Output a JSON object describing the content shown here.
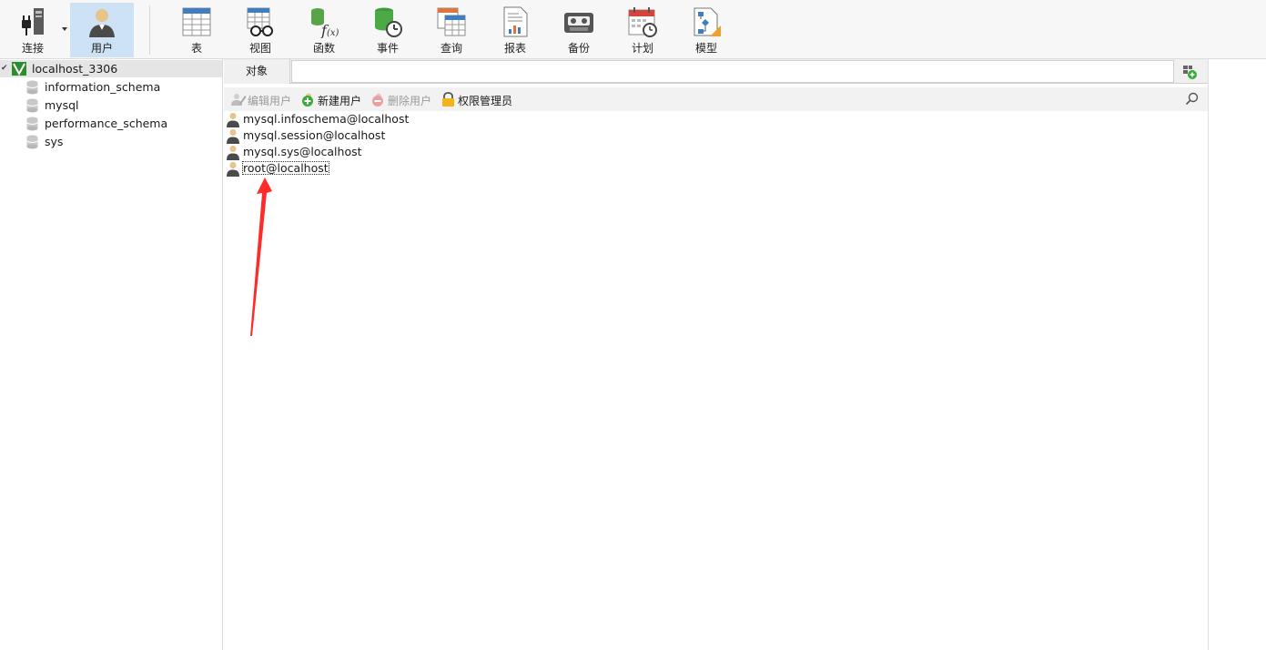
{
  "toolbar": {
    "buttons": [
      {
        "label": "连接",
        "icon": "connection-plug-icon"
      },
      {
        "label": "用户",
        "icon": "user-icon",
        "active": true
      },
      {
        "label": "表",
        "icon": "table-icon"
      },
      {
        "label": "视图",
        "icon": "view-icon"
      },
      {
        "label": "函数",
        "icon": "function-icon"
      },
      {
        "label": "事件",
        "icon": "event-icon"
      },
      {
        "label": "查询",
        "icon": "query-icon"
      },
      {
        "label": "报表",
        "icon": "report-icon"
      },
      {
        "label": "备份",
        "icon": "backup-icon"
      },
      {
        "label": "计划",
        "icon": "schedule-icon"
      },
      {
        "label": "模型",
        "icon": "model-icon"
      }
    ]
  },
  "sidebar": {
    "connection": "localhost_3306",
    "databases": [
      "information_schema",
      "mysql",
      "performance_schema",
      "sys"
    ]
  },
  "main": {
    "tab_label": "对象",
    "object_toolbar": {
      "edit_user": "编辑用户",
      "new_user": "新建用户",
      "delete_user": "删除用户",
      "privilege_manager": "权限管理员"
    },
    "users": [
      "mysql.infoschema@localhost",
      "mysql.session@localhost",
      "mysql.sys@localhost",
      "root@localhost"
    ],
    "selected_user": "root@localhost"
  },
  "colors": {
    "active_toolbar": "#cde3f5",
    "annotation_arrow": "#ff2a2a"
  }
}
